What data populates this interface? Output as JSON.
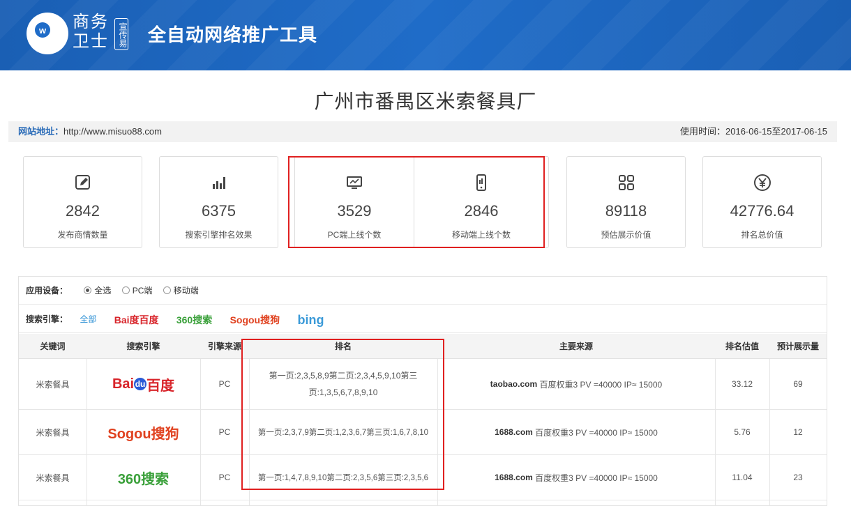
{
  "header": {
    "brand_line1": "商务",
    "brand_line2": "卫士",
    "brand_badge": "宣传易",
    "title": "全自动网络推广工具"
  },
  "company_name": "广州市番禺区米索餐具厂",
  "info": {
    "site_label": "网站地址：",
    "site_url": "http://www.misuo88.com",
    "period_label": "使用时间：",
    "period_value": "2016-06-15至2017-06-15"
  },
  "stats": [
    {
      "icon": "edit-icon",
      "value": "2842",
      "label": "发布商情数量"
    },
    {
      "icon": "bar-chart-icon",
      "value": "6375",
      "label": "搜索引擎排名效果"
    },
    {
      "icon": "monitor-icon",
      "value": "3529",
      "label": "PC端上线个数"
    },
    {
      "icon": "mobile-icon",
      "value": "2846",
      "label": "移动端上线个数"
    },
    {
      "icon": "grid-icon",
      "value": "89118",
      "label": "预估展示价值"
    },
    {
      "icon": "yen-icon",
      "value": "42776.64",
      "label": "排名总价值"
    }
  ],
  "filters": {
    "device_label": "应用设备：",
    "device_options": [
      "全选",
      "PC端",
      "移动端"
    ],
    "device_selected": "全选",
    "engine_label": "搜索引擎：",
    "engine_all": "全部",
    "engine_logos": [
      "Bai度百度",
      "360搜索",
      "Sogou搜狗",
      "bing"
    ]
  },
  "table": {
    "headers": [
      "关键词",
      "搜索引擎",
      "引擎来源",
      "排名",
      "主要来源",
      "排名估值",
      "预计展示量"
    ],
    "rows": [
      {
        "keyword": "米索餐具",
        "engine": "Bai度百度",
        "source": "PC",
        "rank": "第一页:2,3,5,8,9第二页:2,3,4,5,9,10第三页:1,3,5,6,7,8,9,10",
        "main_site": "taobao.com",
        "main_rest": "百度权重3 PV =40000 IP≈ 15000",
        "valuation": "33.12",
        "impressions": "69"
      },
      {
        "keyword": "米索餐具",
        "engine": "Sogou搜狗",
        "source": "PC",
        "rank": "第一页:2,3,7,9第二页:1,2,3,6,7第三页:1,6,7,8,10",
        "main_site": "1688.com",
        "main_rest": "百度权重3 PV =40000 IP≈ 15000",
        "valuation": "5.76",
        "impressions": "12"
      },
      {
        "keyword": "米索餐具",
        "engine": "360搜索",
        "source": "PC",
        "rank": "第一页:1,4,7,8,9,10第二页:2,3,5,6第三页:2,3,5,6",
        "main_site": "1688.com",
        "main_rest": "百度权重3 PV =40000 IP≈ 15000",
        "valuation": "11.04",
        "impressions": "23"
      }
    ]
  }
}
